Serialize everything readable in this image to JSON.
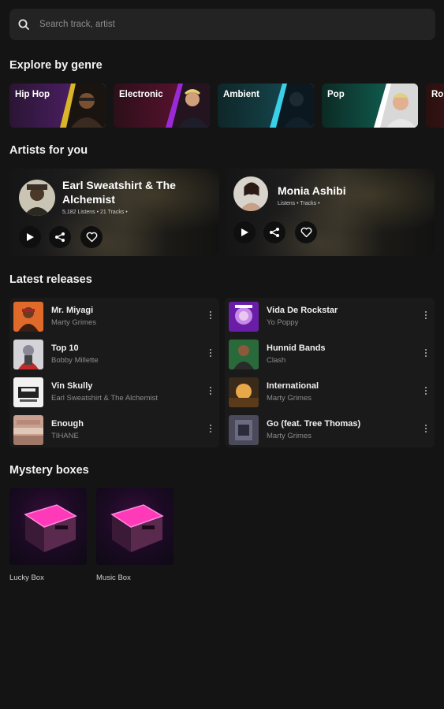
{
  "search": {
    "placeholder": "Search track, artist"
  },
  "sections": {
    "genres": "Explore by genre",
    "artists": "Artists for you",
    "releases": "Latest releases",
    "mystery": "Mystery boxes"
  },
  "genres": [
    {
      "label": "Hip Hop",
      "color": "#4a1d5c"
    },
    {
      "label": "Electronic",
      "color": "#5a1234"
    },
    {
      "label": "Ambient",
      "color": "#12424a"
    },
    {
      "label": "Pop",
      "color": "#0f4a3a"
    },
    {
      "label": "Ro",
      "color": "#4a1818"
    }
  ],
  "artists": [
    {
      "name": "Earl Sweatshirt & The Alchemist",
      "meta": "5,182 Listens • 21 Tracks •"
    },
    {
      "name": "Monia Ashibi",
      "meta": "Listens • Tracks •"
    }
  ],
  "releases_left": [
    {
      "title": "Mr. Miyagi",
      "artist": "Marty Grimes"
    },
    {
      "title": "Top 10",
      "artist": "Bobby Millette"
    },
    {
      "title": "Vin Skully",
      "artist": "Earl Sweatshirt & The Alchemist"
    },
    {
      "title": "Enough",
      "artist": "TIHANE"
    }
  ],
  "releases_right": [
    {
      "title": "Vida De Rockstar",
      "artist": "Yo Poppy"
    },
    {
      "title": "Hunnid Bands",
      "artist": "Clash"
    },
    {
      "title": "International",
      "artist": "Marty Grimes"
    },
    {
      "title": "Go (feat. Tree Thomas)",
      "artist": "Marty Grimes"
    }
  ],
  "mystery_boxes": [
    {
      "label": "Lucky Box"
    },
    {
      "label": "Music Box"
    }
  ],
  "colors": {
    "background": "#141414",
    "accent": "#ff2aa8"
  }
}
